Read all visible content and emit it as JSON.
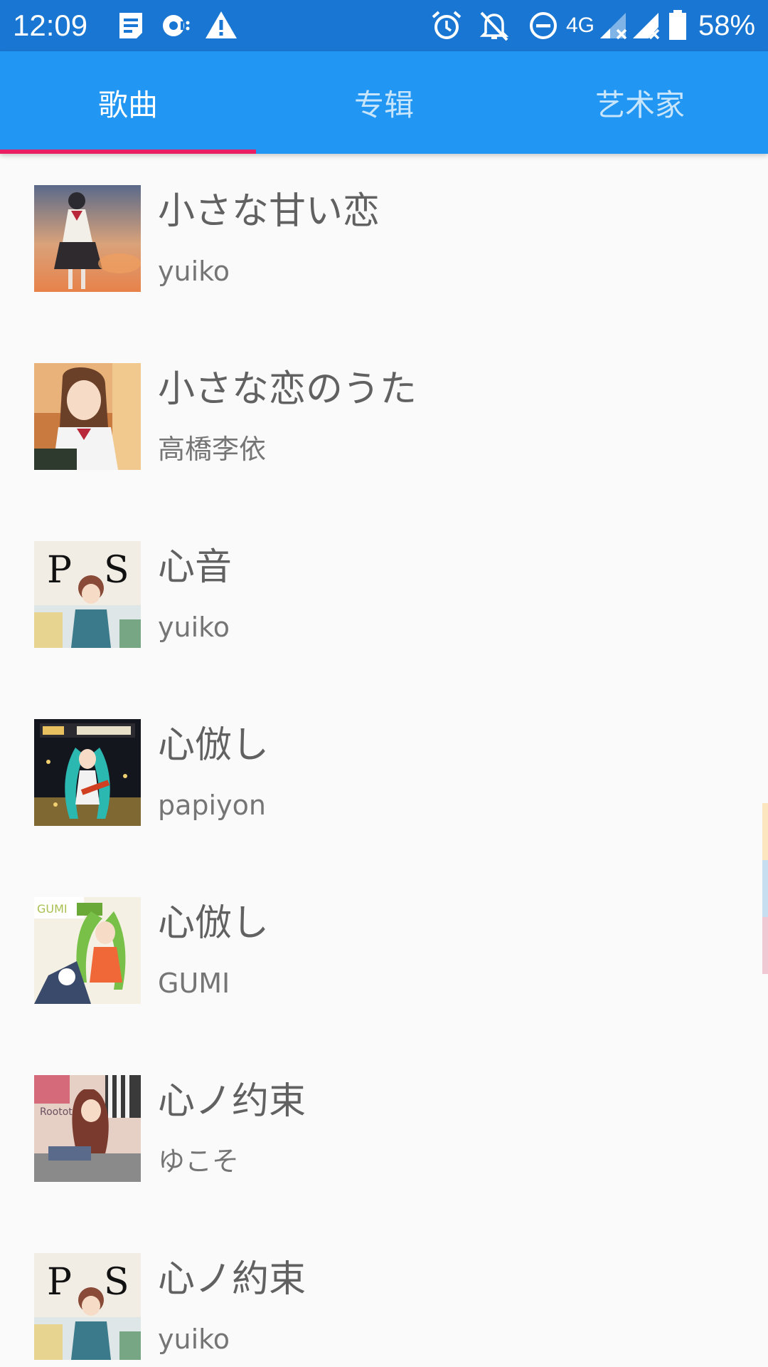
{
  "status_bar": {
    "time": "12:09",
    "network": "4G",
    "battery": "58%",
    "left_icons": [
      "message-icon",
      "sync-icon",
      "warning-icon"
    ],
    "right_icons": [
      "alarm-icon",
      "notifications-off-icon",
      "do-not-disturb-icon",
      "signal-icon",
      "signal-icon",
      "battery-icon"
    ]
  },
  "tabs": [
    {
      "label": "歌曲",
      "active": true
    },
    {
      "label": "专辑",
      "active": false
    },
    {
      "label": "艺术家",
      "active": false
    }
  ],
  "songs": [
    {
      "title": "小さな甘い恋",
      "artist": "yuiko"
    },
    {
      "title": "小さな恋のうた",
      "artist": "高橋李依"
    },
    {
      "title": "心音",
      "artist": "yuiko"
    },
    {
      "title": "心倣し",
      "artist": "papiyon"
    },
    {
      "title": "心倣し",
      "artist": "GUMI"
    },
    {
      "title": "心ノ约束",
      "artist": "ゆこそ"
    },
    {
      "title": "心ノ約束",
      "artist": "yuiko"
    }
  ],
  "colors": {
    "status_bar": "#1976d2",
    "tab_bar": "#2196f3",
    "tab_indicator": "#e91e63",
    "background": "#fafafa",
    "title_text": "#616161",
    "artist_text": "#757575"
  }
}
